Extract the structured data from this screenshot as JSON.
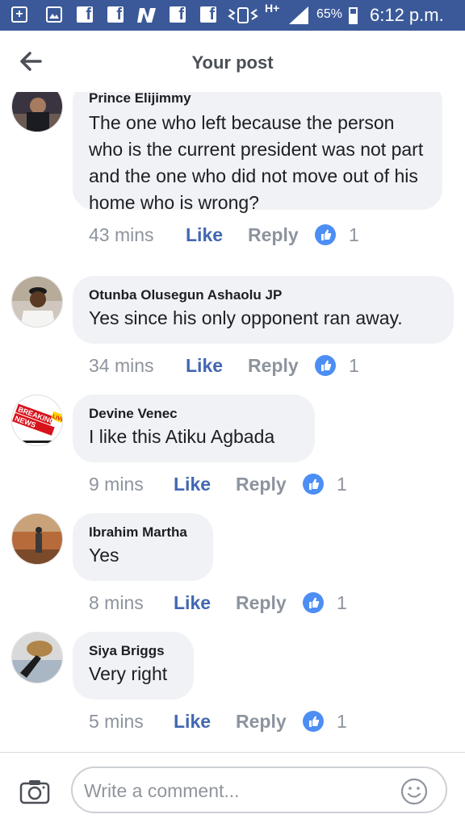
{
  "status_bar": {
    "network": "H+",
    "battery": "65%",
    "time": "6:12 p.m.",
    "bg_color": "#3b5998"
  },
  "header": {
    "title": "Your post",
    "back_icon": "back-arrow-icon"
  },
  "comments": [
    {
      "author": "Prince Elijimmy",
      "text": "The one who left because the person who is the current president was not part and the one who did not move out of his home who is wrong?",
      "time": "43 mins",
      "like": "Like",
      "reply": "Reply",
      "reactions": "1"
    },
    {
      "author": "Otunba Olusegun Ashaolu JP",
      "text": "Yes since his only opponent ran away.",
      "time": "34 mins",
      "like": "Like",
      "reply": "Reply",
      "reactions": "1"
    },
    {
      "author": "Devine Venec",
      "text": "I like this Atiku Agbada",
      "time": "9 mins",
      "like": "Like",
      "reply": "Reply",
      "reactions": "1",
      "avatar_lettering": "BREAKING NEWS LIVE"
    },
    {
      "author": "Ibrahim Martha",
      "text": "Yes",
      "time": "8 mins",
      "like": "Like",
      "reply": "Reply",
      "reactions": "1"
    },
    {
      "author": "Siya Briggs",
      "text": "Very right",
      "time": "5 mins",
      "like": "Like",
      "reply": "Reply",
      "reactions": "1"
    }
  ],
  "composer": {
    "placeholder": "Write a comment...",
    "camera_icon": "camera-icon",
    "emoji_icon": "smiley-icon"
  },
  "colors": {
    "link_blue": "#4267b2",
    "reaction_blue": "#4d8ef5",
    "bubble": "#f0f2f5",
    "muted": "#8d949e"
  }
}
